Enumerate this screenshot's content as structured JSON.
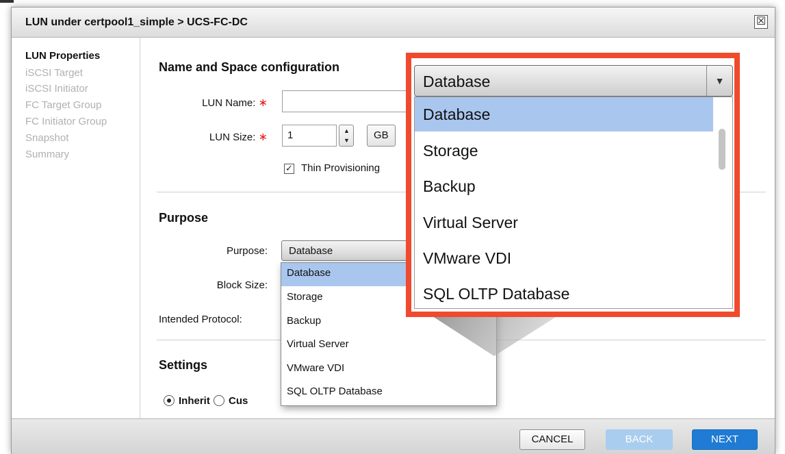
{
  "dialog": {
    "title": "LUN under certpool1_simple > UCS-FC-DC",
    "close_label": "☒"
  },
  "sidebar": {
    "items": [
      {
        "label": "LUN Properties",
        "active": true
      },
      {
        "label": "iSCSI Target",
        "active": false
      },
      {
        "label": "iSCSI Initiator",
        "active": false
      },
      {
        "label": "FC Target Group",
        "active": false
      },
      {
        "label": "FC Initiator Group",
        "active": false
      },
      {
        "label": "Snapshot",
        "active": false
      },
      {
        "label": "Summary",
        "active": false
      }
    ]
  },
  "name_space": {
    "section_title": "Name and Space configuration",
    "lun_name_label": "LUN Name:",
    "lun_name_value": "",
    "required_mark": "∗",
    "lun_size_label": "LUN Size:",
    "lun_size_value": "1",
    "unit_label": "GB",
    "thin_provisioning_label": "Thin Provisioning",
    "thin_provisioning_checked": true
  },
  "purpose": {
    "section_title": "Purpose",
    "purpose_label": "Purpose:",
    "purpose_value": "Database",
    "block_size_label": "Block Size:",
    "intended_protocol_label": "Intended Protocol:",
    "options": [
      "Database",
      "Storage",
      "Backup",
      "Virtual Server",
      "VMware VDI",
      "SQL OLTP Database"
    ],
    "selected_option": "Database"
  },
  "settings": {
    "section_title": "Settings",
    "inherit_label": "Inherit",
    "custom_label_visible": "Cus"
  },
  "footer": {
    "cancel_label": "CANCEL",
    "back_label": "BACK",
    "next_label": "NEXT"
  },
  "zoom_callout": {
    "selected_value": "Database",
    "options": [
      "Database",
      "Storage",
      "Backup",
      "Virtual Server",
      "VMware VDI",
      "SQL OLTP Database"
    ],
    "highlight_color": "#f04a2e"
  },
  "colors": {
    "selection": "#a9c6ee",
    "primary_button": "#1f7bd3",
    "disabled_button": "#a9cdee",
    "required": "#e02020"
  }
}
